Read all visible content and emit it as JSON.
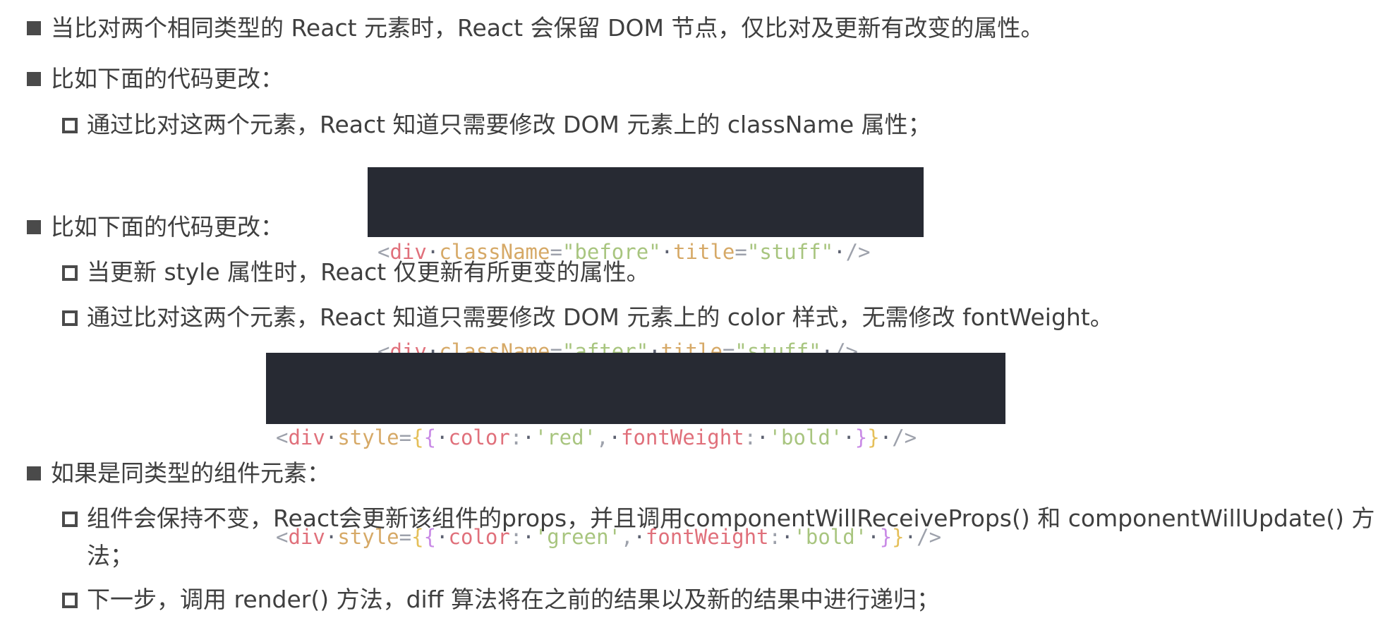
{
  "items": [
    {
      "level": 1,
      "text": "当比对两个相同类型的 React 元素时，React 会保留 DOM 节点，仅比对及更新有改变的属性。"
    },
    {
      "level": 1,
      "text": "比如下面的代码更改："
    },
    {
      "level": 2,
      "text": "通过比对这两个元素，React 知道只需要修改 DOM 元素上的 className 属性；"
    },
    {
      "level": 1,
      "text": "比如下面的代码更改："
    },
    {
      "level": 2,
      "text": "当更新 style 属性时，React 仅更新有所更变的属性。"
    },
    {
      "level": 2,
      "text": "通过比对这两个元素，React 知道只需要修改 DOM 元素上的 color 样式，无需修改 fontWeight。"
    },
    {
      "level": 1,
      "text": "如果是同类型的组件元素："
    },
    {
      "level": 2,
      "text": "组件会保持不变，React会更新该组件的props，并且调用componentWillReceiveProps() 和 componentWillUpdate() 方"
    },
    {
      "level": 2,
      "text": "法；"
    },
    {
      "level": 2,
      "text": "下一步，调用 render() 方法，diff 算法将在之前的结果以及新的结果中进行递归；"
    }
  ],
  "code1": {
    "tag": "div",
    "lines": [
      {
        "a1": "className",
        "v1": "\"before\"",
        "a2": "title",
        "v2": "\"stuff\""
      },
      {
        "a1": "className",
        "v1": "\"after\"",
        "a2": "title",
        "v2": "\"stuff\""
      }
    ]
  },
  "code2": {
    "tag": "div",
    "attr": "style",
    "lines": [
      {
        "k1": "color",
        "v1": "'red'",
        "k2": "fontWeight",
        "v2": "'bold'"
      },
      {
        "k1": "color",
        "v1": "'green'",
        "k2": "fontWeight",
        "v2": "'bold'"
      }
    ]
  }
}
